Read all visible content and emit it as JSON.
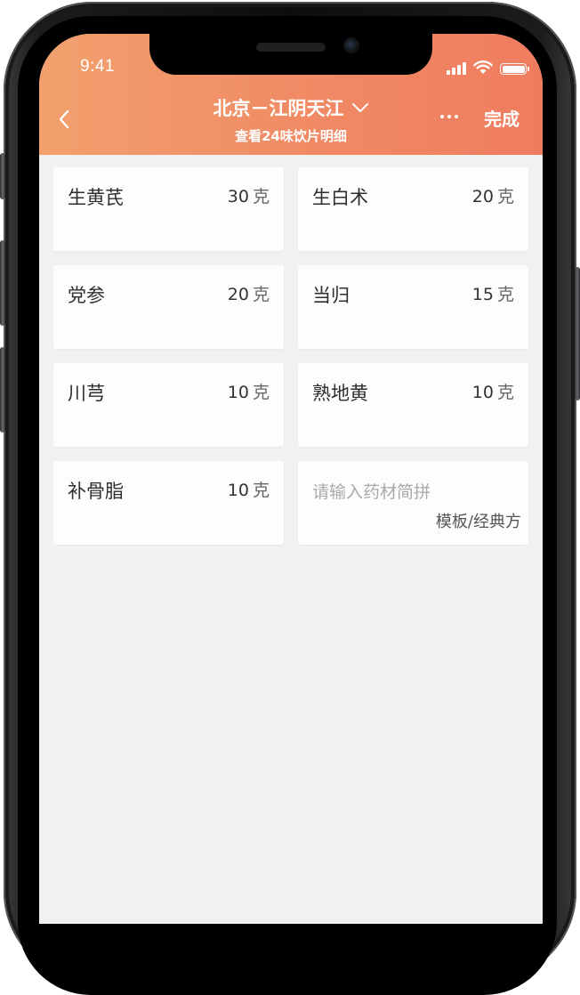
{
  "status_bar": {
    "time": "9:41"
  },
  "header": {
    "title": "北京－江阴天江",
    "subtitle": "查看24味饮片明细",
    "done_label": "完成",
    "accent_color": "#f08a64"
  },
  "icons": {
    "back": "chevron-left-icon",
    "dropdown": "chevron-down-icon",
    "more": "more-dots-icon"
  },
  "herbs": [
    {
      "name": "生黄芪",
      "amount": "30",
      "unit": "克"
    },
    {
      "name": "生白术",
      "amount": "20",
      "unit": "克"
    },
    {
      "name": "党参",
      "amount": "20",
      "unit": "克"
    },
    {
      "name": "当归",
      "amount": "15",
      "unit": "克"
    },
    {
      "name": "川芎",
      "amount": "10",
      "unit": "克"
    },
    {
      "name": "熟地黄",
      "amount": "10",
      "unit": "克"
    },
    {
      "name": "补骨脂",
      "amount": "10",
      "unit": "克"
    }
  ],
  "input_card": {
    "placeholder": "请输入药材简拼",
    "template_link": "模板/经典方"
  }
}
